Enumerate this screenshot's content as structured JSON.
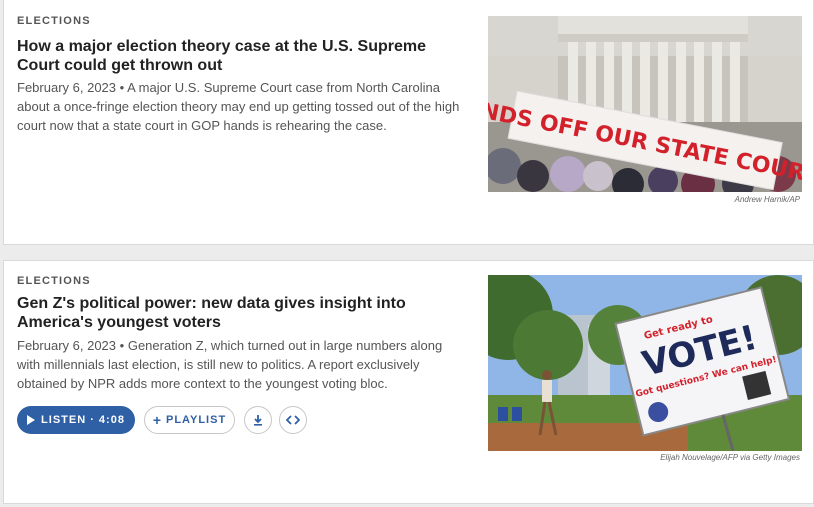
{
  "stories": [
    {
      "slug": "ELECTIONS",
      "title": "How a major election theory case at the U.S. Supreme Court could get thrown out",
      "date": "February 6, 2023",
      "bullet": "•",
      "teaser": "A major U.S. Supreme Court case from North Carolina about a once-fringe election theory may end up getting tossed out of the high court now that a state court in GOP hands is rehearing the case.",
      "photo_sign_text": "HANDS OFF OUR STATE COURTS!",
      "credit": "Andrew Harnik/AP"
    },
    {
      "slug": "ELECTIONS",
      "title": "Gen Z's political power: new data gives insight into America's youngest voters",
      "date": "February 6, 2023",
      "bullet": "•",
      "teaser": "Generation Z, which turned out in large numbers along with millennials last election, is still new to politics. A report exclusively obtained by NPR adds more context to the youngest voting bloc.",
      "photo_sign_top": "Get ready to",
      "photo_sign_main": "VOTE!",
      "photo_sign_sub": "Got questions? We can help!",
      "credit": "Elijah Nouvelage/AFP via Getty Images",
      "audio": {
        "listen_label": "LISTEN · 4:08",
        "playlist_label": "PLAYLIST",
        "playlist_icon": "+"
      }
    }
  ],
  "colors": {
    "accent": "#2f5fa5",
    "sign_red": "#d3212c"
  }
}
